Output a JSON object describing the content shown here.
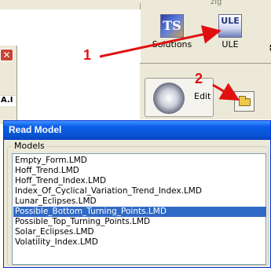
{
  "topbar": {
    "fragment": "zig"
  },
  "bg_window": {
    "close_glyph": "✕",
    "cell_text": "A.I"
  },
  "toolbar": {
    "scroll_up": "▲",
    "scroll_down": "▼",
    "tools": [
      {
        "icon": "ts-icon",
        "icon_text": "TS",
        "label": "Solutions"
      },
      {
        "icon": "ule-icon",
        "icon_text": "ULE",
        "label": "ULE"
      }
    ]
  },
  "panel": {
    "edit_label": "Edit",
    "folder_icon": "open-folder-icon"
  },
  "annotations": {
    "callout_1": "1",
    "callout_2": "2",
    "color": "#e01010"
  },
  "dialog": {
    "title": "Read Model",
    "group_label": "Models",
    "items": [
      "Empty_Form.LMD",
      "Hoff_Trend.LMD",
      "Hoff_Trend_Index.LMD",
      "Index_Of_Cyclical_Variation_Trend_Index.LMD",
      "Lunar_Eclipses.LMD",
      "Possible_Bottom_Turning_Points.LMD",
      "Possible_Top_Turning_Points.LMD",
      "Solar_Eclipses.LMD",
      "Volatility_Index.LMD"
    ],
    "selected_index": 5
  },
  "colors": {
    "titlebar": "#0a5ce8",
    "selection": "#316ac5",
    "window_bg": "#ece9d8"
  }
}
